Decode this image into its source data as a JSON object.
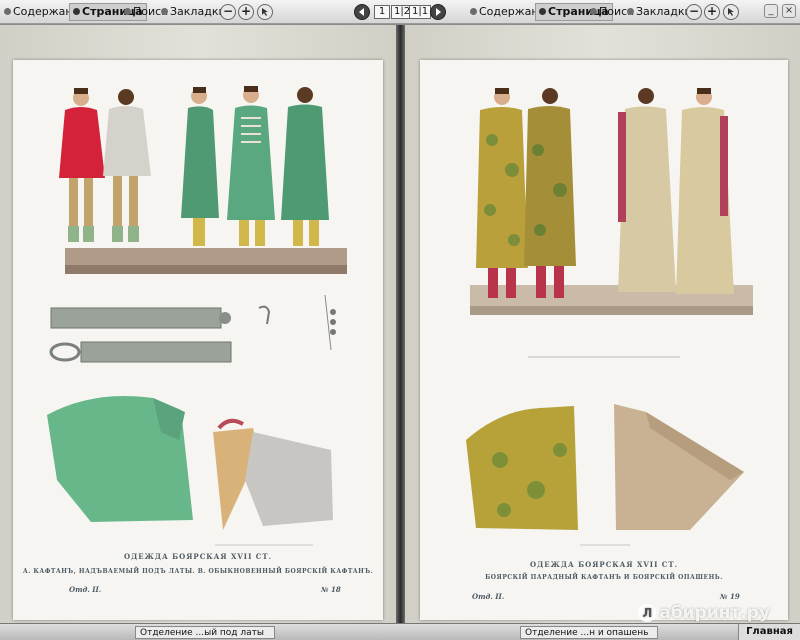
{
  "toolbar_left": {
    "tabs": [
      {
        "label": "Содержание",
        "active": false
      },
      {
        "label": "Страница",
        "active": true
      },
      {
        "label": "Поиск",
        "active": false
      },
      {
        "label": "Закладки",
        "active": false
      }
    ],
    "zoom_out": "−",
    "zoom_in": "+"
  },
  "pager": {
    "page": "1",
    "two_pages": "1|2",
    "fit": "1|1"
  },
  "toolbar_right": {
    "tabs": [
      {
        "label": "Содержание",
        "active": false
      },
      {
        "label": "Страница",
        "active": true
      },
      {
        "label": "Поиск",
        "active": false
      },
      {
        "label": "Закладки",
        "active": false
      }
    ],
    "zoom_out": "−",
    "zoom_in": "+"
  },
  "window": {
    "minimize": "_",
    "close": "×"
  },
  "left_plate": {
    "title": "ОДЕЖДА БОЯРСКАЯ XVII СТ.",
    "subtitle": "А. КАФТАНЪ, НАДЪВАЕМЫЙ ПОДЪ ЛАТЫ. В. ОБЫКНОВЕННЫЙ БОЯРСКІЙ КАФТАНЪ.",
    "section": "Отд. II.",
    "number": "№ 18"
  },
  "right_plate": {
    "title": "ОДЕЖДА БОЯРСКАЯ XVII СТ.",
    "subtitle": "БОЯРСКІЙ ПАРАДНЫЙ КАФТАНЪ И БОЯРСКІЙ ОПАШЕНЬ.",
    "section": "Отд. II.",
    "number": "№ 19"
  },
  "bottom_bar": {
    "left_tab": "Отделение ...ый под латы",
    "right_tab": "Отделение ...н и опашень",
    "home": "Главная"
  },
  "watermark": {
    "badge": "Л",
    "text": "абиринт.ру"
  },
  "icons": [
    "minus-icon",
    "plus-icon",
    "pointer-icon",
    "arrow-left-icon",
    "arrow-right-icon"
  ]
}
